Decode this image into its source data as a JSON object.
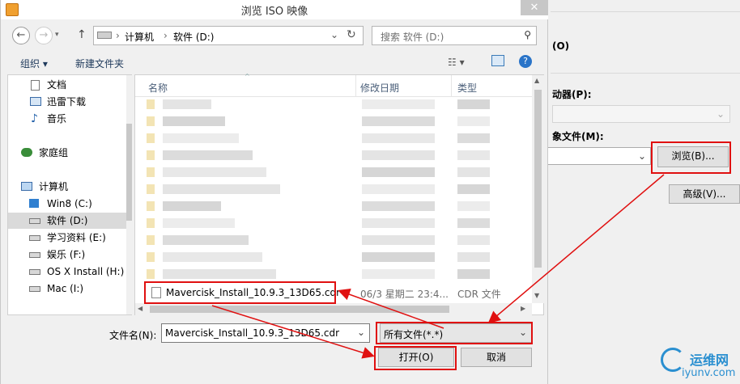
{
  "dialog": {
    "title": "浏览 ISO 映像",
    "close_glyph": "✕",
    "nav": {
      "back": "←",
      "forward": "→",
      "up": "↑"
    },
    "address": {
      "crumb1": "计算机",
      "crumb2": "软件 (D:)"
    },
    "search_placeholder": "搜索 软件 (D:)",
    "toolbar": {
      "organize": "组织 ▾",
      "new_folder": "新建文件夹"
    },
    "sidebar": [
      {
        "label": "文档"
      },
      {
        "label": "迅雷下载"
      },
      {
        "label": "音乐"
      },
      {
        "label": "家庭组"
      },
      {
        "label": "计算机"
      },
      {
        "label": "Win8 (C:)"
      },
      {
        "label": "软件 (D:)"
      },
      {
        "label": "学习资料 (E:)"
      },
      {
        "label": "娱乐 (F:)"
      },
      {
        "label": "OS X Install (H:)"
      },
      {
        "label": "Mac (I:)"
      }
    ],
    "columns": {
      "name": "名称",
      "modified": "修改日期",
      "type": "类型"
    },
    "selected_file": {
      "name": "Mavercisk_Install_10.9.3_13D65.cdr",
      "date": "06/3 星期二 23:4...",
      "type": "CDR 文件"
    },
    "filename_label": "文件名(N):",
    "filename_value": "Mavercisk_Install_10.9.3_13D65.cdr",
    "filter_value": "所有文件(*.*)",
    "open_button": "打开(O)",
    "cancel_button": "取消"
  },
  "background": {
    "label_o": "(O)",
    "label_p": "动器(P):",
    "label_m": "象文件(M):",
    "browse_button": "浏览(B)...",
    "advanced_button": "高级(V)..."
  },
  "watermark": {
    "name": "运维网",
    "url": "iyunv.com"
  },
  "colors": {
    "accent_red": "#e01010",
    "selection": "#cde8ff"
  }
}
